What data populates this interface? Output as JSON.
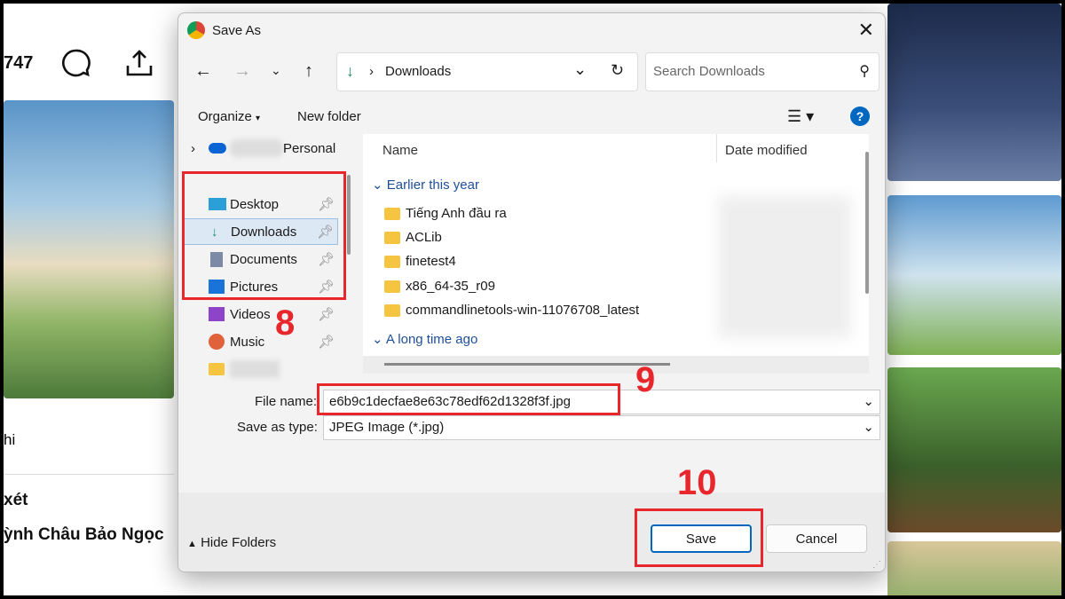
{
  "background": {
    "likes_count": "747",
    "partial_text_1": "hi",
    "comments_heading": "xét",
    "commenter_name": "ỳnh Châu Bảo Ngọc"
  },
  "dialog": {
    "title": "Save As",
    "address": {
      "current": "Downloads"
    },
    "search": {
      "placeholder": "Search Downloads"
    },
    "toolbar": {
      "organize": "Organize",
      "new_folder": "New folder"
    },
    "nav": {
      "cloud": "Personal",
      "items": [
        {
          "label": "Desktop",
          "icon": "desktop-icon"
        },
        {
          "label": "Downloads",
          "icon": "download-icon",
          "selected": true
        },
        {
          "label": "Documents",
          "icon": "documents-icon"
        },
        {
          "label": "Pictures",
          "icon": "pictures-icon"
        },
        {
          "label": "Videos",
          "icon": "videos-icon"
        },
        {
          "label": "Music",
          "icon": "music-icon"
        }
      ]
    },
    "columns": {
      "name": "Name",
      "date_modified": "Date modified"
    },
    "groups": [
      {
        "label": "Earlier this year",
        "items": [
          "Tiếng Anh đầu ra",
          "ACLib",
          "finetest4",
          "x86_64-35_r09",
          "commandlinetools-win-11076708_latest"
        ]
      },
      {
        "label": "A long time ago",
        "items": []
      }
    ],
    "file_name_label": "File name:",
    "file_name": "e6b9c1decfae8e63c78edf62d1328f3f.jpg",
    "save_type_label": "Save as type:",
    "save_type": "JPEG Image (*.jpg)",
    "hide_folders": "Hide Folders",
    "save": "Save",
    "cancel": "Cancel"
  },
  "annotations": {
    "step8": "8",
    "step9": "9",
    "step10": "10"
  },
  "colors": {
    "annotation": "#e8272d",
    "accent": "#0067c0"
  }
}
